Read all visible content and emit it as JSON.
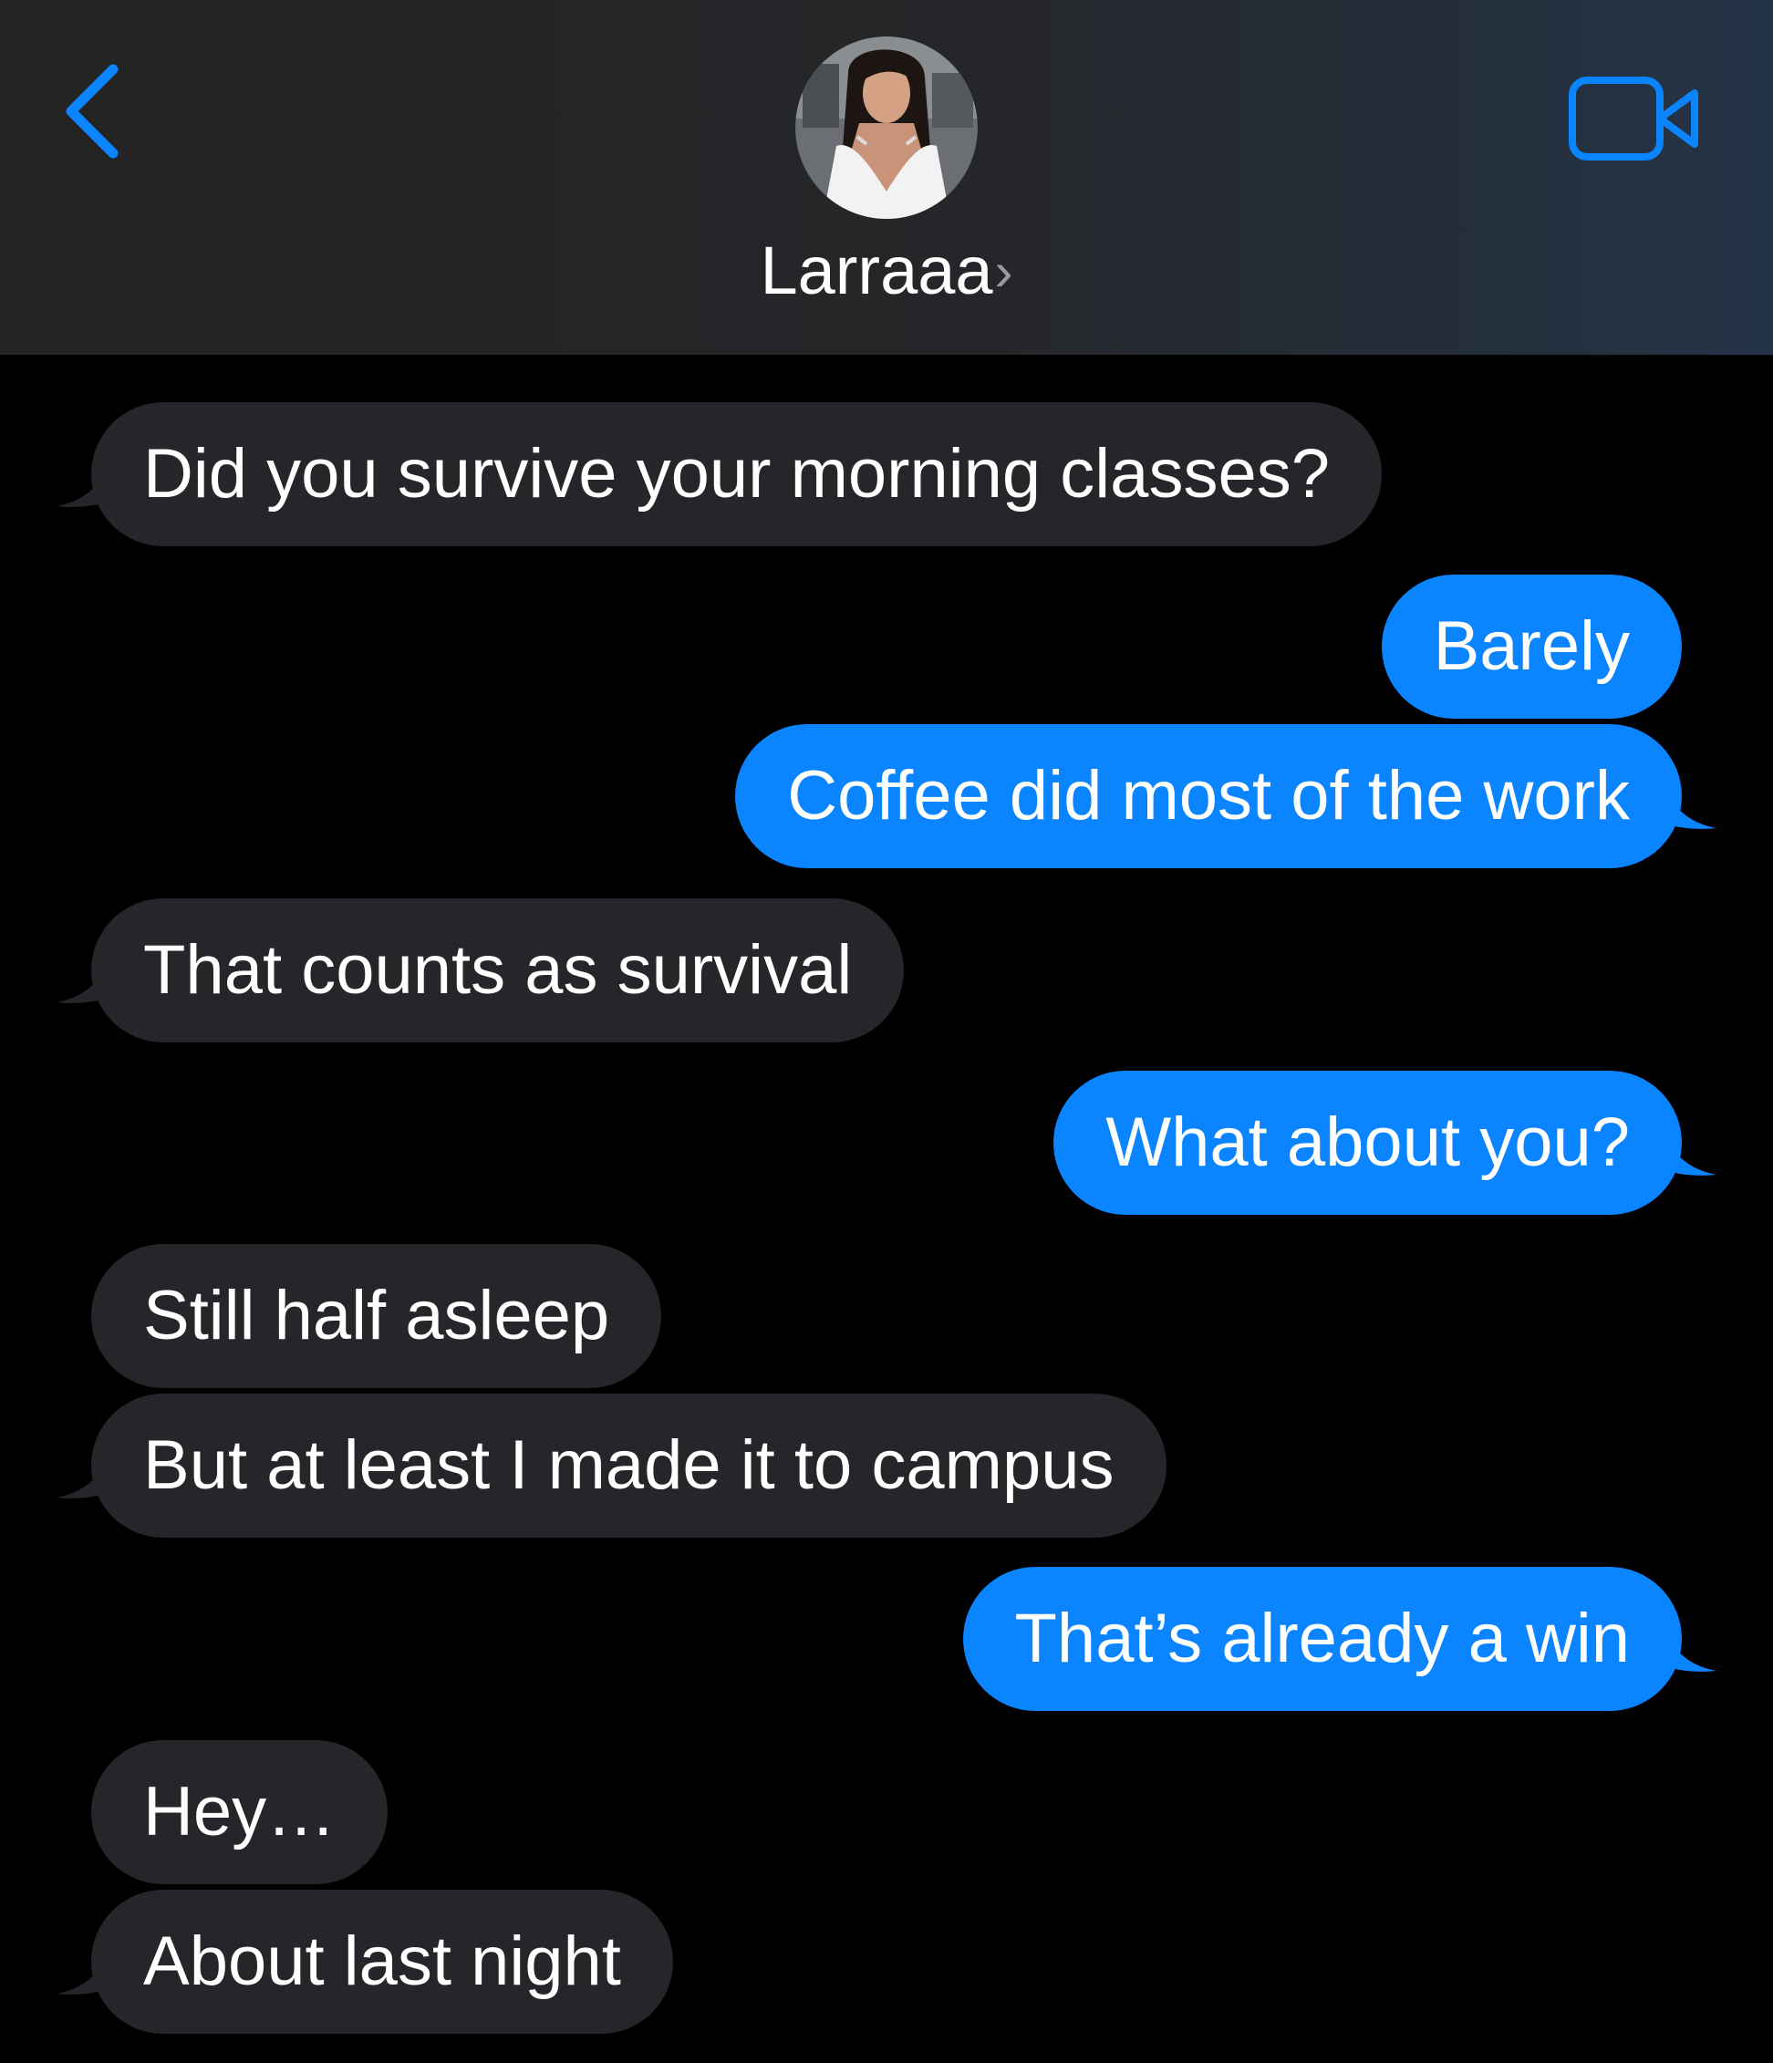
{
  "header": {
    "contact_name": "Larraaa",
    "chevron": "›",
    "back_icon": "chevron-left-icon",
    "video_icon": "video-camera-icon",
    "accent_color": "#0a84ff"
  },
  "messages": [
    {
      "direction": "in",
      "text": "Did you survive your morning classes?"
    },
    {
      "direction": "out",
      "text": "Barely"
    },
    {
      "direction": "out",
      "text": "Coffee did most of the work"
    },
    {
      "direction": "in",
      "text": "That counts as survival"
    },
    {
      "direction": "out",
      "text": "What about you?"
    },
    {
      "direction": "in",
      "text": "Still half asleep"
    },
    {
      "direction": "in",
      "text": "But at least I made it to campus"
    },
    {
      "direction": "out",
      "text": "That’s already a win"
    },
    {
      "direction": "in",
      "text": "Hey…"
    },
    {
      "direction": "in",
      "text": "About last night"
    }
  ],
  "colors": {
    "incoming_bubble": "#26252a",
    "outgoing_bubble": "#0a84ff",
    "background": "#000000"
  }
}
